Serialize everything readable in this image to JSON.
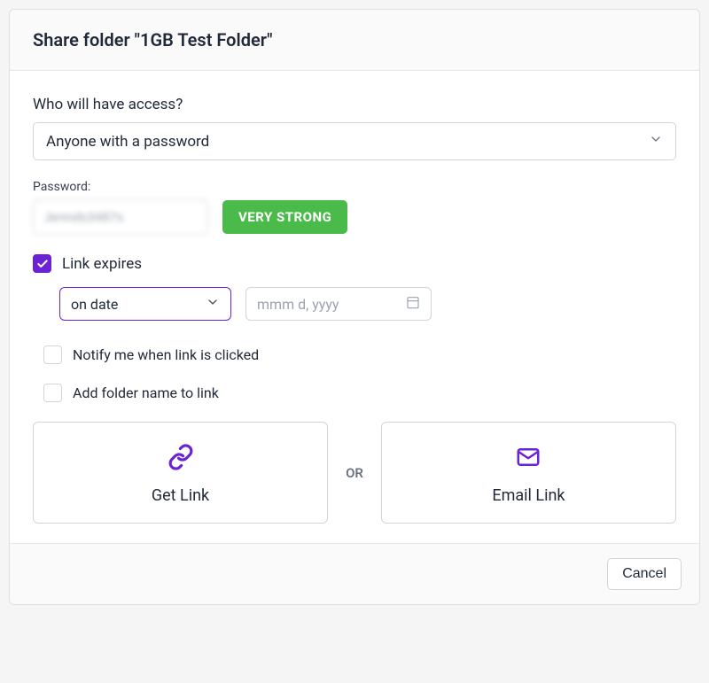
{
  "dialog": {
    "title": "Share folder \"1GB Test Folder\""
  },
  "access": {
    "label": "Who will have access?",
    "selected": "Anyone with a password"
  },
  "password": {
    "label": "Password:",
    "value": "Jennds3487s",
    "strength": "VERY STRONG"
  },
  "linkExpires": {
    "label": "Link expires",
    "checked": true,
    "modeSelected": "on date",
    "datePlaceholder": "mmm d, yyyy"
  },
  "notify": {
    "label": "Notify me when link is clicked",
    "checked": false
  },
  "addFolderName": {
    "label": "Add folder name to link",
    "checked": false
  },
  "actions": {
    "getLink": "Get Link",
    "or": "OR",
    "emailLink": "Email Link"
  },
  "footer": {
    "cancel": "Cancel"
  },
  "colors": {
    "accent": "#6b21d4",
    "strength": "#4aba4a"
  }
}
